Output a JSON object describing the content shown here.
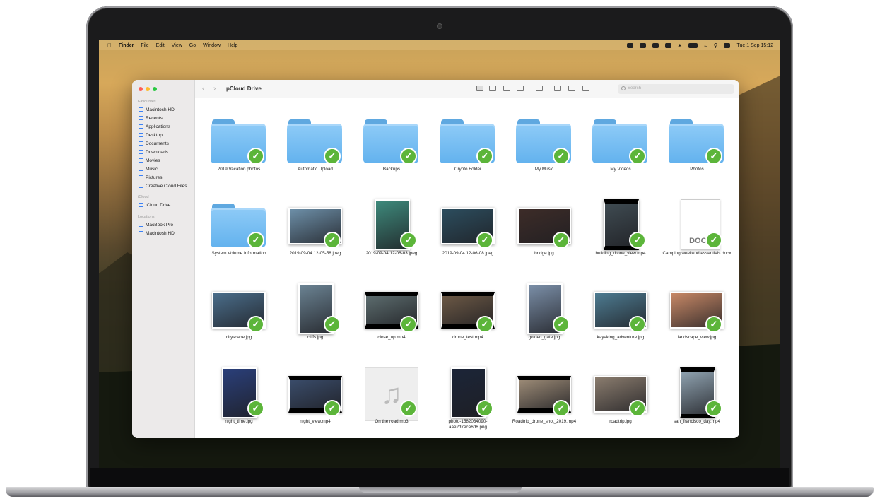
{
  "menubar": {
    "apple": "",
    "app": "Finder",
    "menus": [
      "File",
      "Edit",
      "View",
      "Go",
      "Window",
      "Help"
    ],
    "clock": "Tue 1 Sep  15:12"
  },
  "window": {
    "title": "pCloud Drive",
    "search_placeholder": "Search"
  },
  "sidebar": {
    "favourites_title": "Favourites",
    "favourites": [
      "Macintosh HD",
      "Recents",
      "Applications",
      "Desktop",
      "Documents",
      "Downloads",
      "Movies",
      "Music",
      "Pictures",
      "Creative Cloud Files"
    ],
    "icloud_title": "iCloud",
    "icloud": [
      "iCloud Drive"
    ],
    "locations_title": "Locations",
    "locations": [
      "MacBook Pro",
      "Macintosh HD"
    ]
  },
  "files": [
    {
      "name": "2019 Vacation photos",
      "kind": "folder"
    },
    {
      "name": "Automatic Upload",
      "kind": "folder"
    },
    {
      "name": "Backups",
      "kind": "folder"
    },
    {
      "name": "Crypto Folder",
      "kind": "folder"
    },
    {
      "name": "My Music",
      "kind": "folder"
    },
    {
      "name": "My Videos",
      "kind": "folder"
    },
    {
      "name": "Photos",
      "kind": "folder"
    },
    {
      "name": "System Volume Information",
      "kind": "folder"
    },
    {
      "name": "2019-09-04 12-05-58.jpeg",
      "kind": "photo",
      "color": "#6d8fa8"
    },
    {
      "name": "2019-09-04 12-06-03.jpeg",
      "kind": "photo",
      "color": "#3e8a7c"
    },
    {
      "name": "2019-09-04 12-06-08.jpeg",
      "kind": "photo",
      "color": "#2c4d5e"
    },
    {
      "name": "bridge.jpg",
      "kind": "photo",
      "color": "#3d2c28"
    },
    {
      "name": "building_drone_view.mp4",
      "kind": "video",
      "color": "#3f4b52"
    },
    {
      "name": "Camping weekend essentials.docx",
      "kind": "doc",
      "badge": "DOCX"
    },
    {
      "name": "cityscape.jpg",
      "kind": "photo",
      "color": "#4a6d8a"
    },
    {
      "name": "cliffs.jpg",
      "kind": "photo",
      "color": "#6b8393"
    },
    {
      "name": "close_up.mp4",
      "kind": "video",
      "color": "#5c6c6e"
    },
    {
      "name": "drone_test.mp4",
      "kind": "video",
      "color": "#6b5845"
    },
    {
      "name": "golden_gate.jpg",
      "kind": "photo",
      "color": "#7b8fa8"
    },
    {
      "name": "kayaking_adventure.jpg",
      "kind": "photo",
      "color": "#4d7b91"
    },
    {
      "name": "landscape_view.jpg",
      "kind": "photo",
      "color": "#c78866"
    },
    {
      "name": "night_time.jpg",
      "kind": "photo",
      "color": "#2a3f7a"
    },
    {
      "name": "night_view.mp4",
      "kind": "video",
      "color": "#3a4c6a"
    },
    {
      "name": "On the road.mp3",
      "kind": "music"
    },
    {
      "name": "photo-1582034090-aae2d7ece6d6.png",
      "kind": "photo",
      "color": "#1c2538"
    },
    {
      "name": "Roadtrip_drone_shot_2019.mp4",
      "kind": "video",
      "color": "#9b8a76"
    },
    {
      "name": "roadtrip.jpg",
      "kind": "photo",
      "color": "#8a7c6e"
    },
    {
      "name": "san_francisco_day.mp4",
      "kind": "video",
      "color": "#8fa2b0"
    }
  ]
}
